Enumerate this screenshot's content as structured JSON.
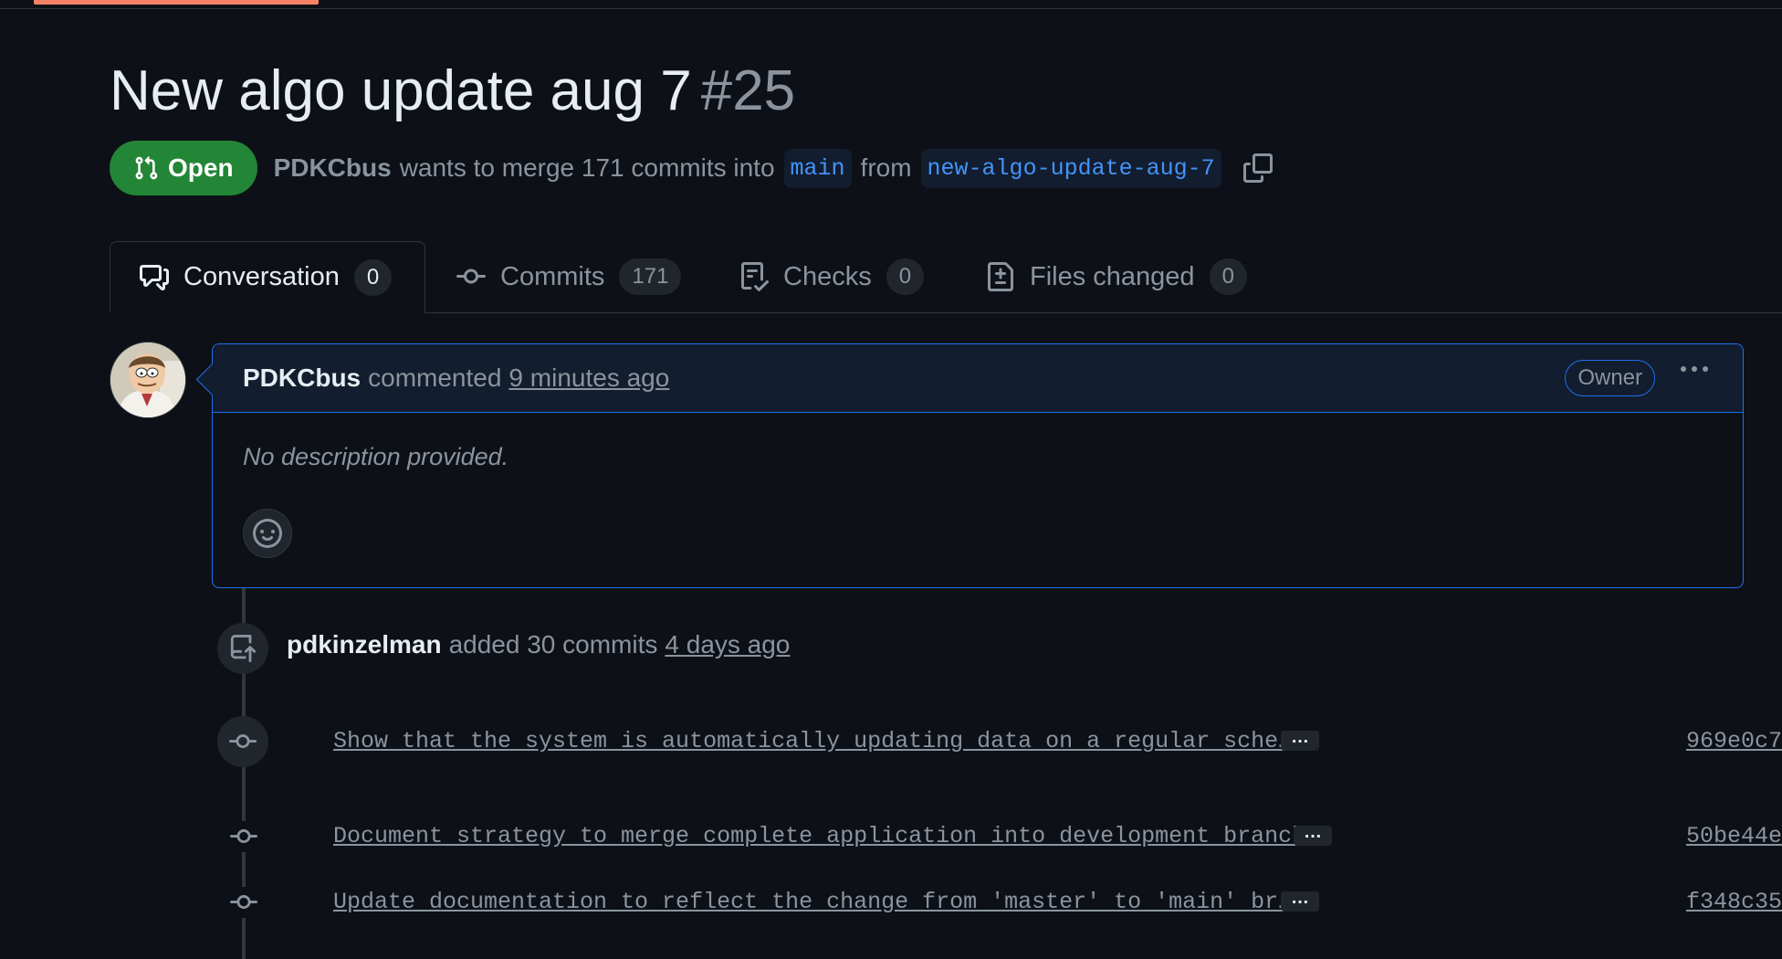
{
  "pr": {
    "title": "New algo update aug 7",
    "number": "#25",
    "state": "Open",
    "author": "PDKCbus",
    "summary_mid": "wants to merge 171 commits into",
    "base_branch": "main",
    "from_word": "from",
    "head_branch": "new-algo-update-aug-7"
  },
  "tabs": [
    {
      "label": "Conversation",
      "count": "0"
    },
    {
      "label": "Commits",
      "count": "171"
    },
    {
      "label": "Checks",
      "count": "0"
    },
    {
      "label": "Files changed",
      "count": "0"
    }
  ],
  "comment": {
    "author": "PDKCbus",
    "action": "commented",
    "time": "9 minutes ago",
    "role": "Owner",
    "body": "No description provided."
  },
  "event": {
    "actor": "pdkinzelman",
    "action": "added 30 commits",
    "time": "4 days ago"
  },
  "commits": [
    {
      "message": "Show that the system is automatically updating data on a regular sche…",
      "sha": "969e0c7"
    },
    {
      "message": "Document strategy to merge complete application into development branch",
      "sha": "50be44e"
    },
    {
      "message": "Update documentation to reflect the change from 'master' to 'main' br…",
      "sha": "f348c35"
    }
  ],
  "colors": {
    "background": "#0d1117",
    "open_badge": "#238636",
    "accent_blue": "#1f6feb",
    "branch_text": "#4493f8",
    "progress": "#f78166"
  }
}
